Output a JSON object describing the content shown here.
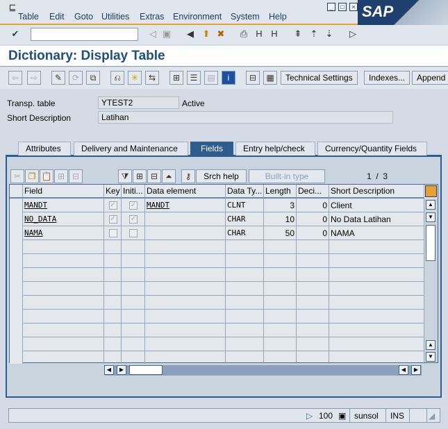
{
  "menu": [
    "Table",
    "Edit",
    "Goto",
    "Utilities",
    "Extras",
    "Environment",
    "System",
    "Help"
  ],
  "logo": "SAP",
  "title": "Dictionary: Display Table",
  "app_toolbar": {
    "technical_settings": "Technical Settings",
    "indexes": "Indexes...",
    "append": "Append"
  },
  "form": {
    "transp_label": "Transp. table",
    "transp_value": "YTEST2",
    "status": "Active",
    "short_desc_label": "Short Description",
    "short_desc_value": "Latihan"
  },
  "tabs": [
    "Attributes",
    "Delivery and Maintenance",
    "Fields",
    "Entry help/check",
    "Currency/Quantity Fields"
  ],
  "table_toolbar": {
    "srch_help": "Srch help",
    "builtin": "Built-in type",
    "page": "1  /  3"
  },
  "columns": [
    "Field",
    "Key",
    "Initi...",
    "Data element",
    "Data Ty...",
    "Length",
    "Deci...",
    "Short Description"
  ],
  "rows": [
    {
      "field": "MANDT",
      "key": true,
      "init": true,
      "elem": "MANDT",
      "type": "CLNT",
      "len": "3",
      "dec": "0",
      "desc": "Client"
    },
    {
      "field": "NO_DATA",
      "key": true,
      "init": true,
      "elem": "",
      "type": "CHAR",
      "len": "10",
      "dec": "0",
      "desc": "No Data Latihan"
    },
    {
      "field": "NAMA",
      "key": false,
      "init": false,
      "elem": "",
      "type": "CHAR",
      "len": "50",
      "dec": "0",
      "desc": "NAMA"
    }
  ],
  "status": {
    "zoom": "100",
    "server": "sunsol",
    "mode": "INS"
  }
}
